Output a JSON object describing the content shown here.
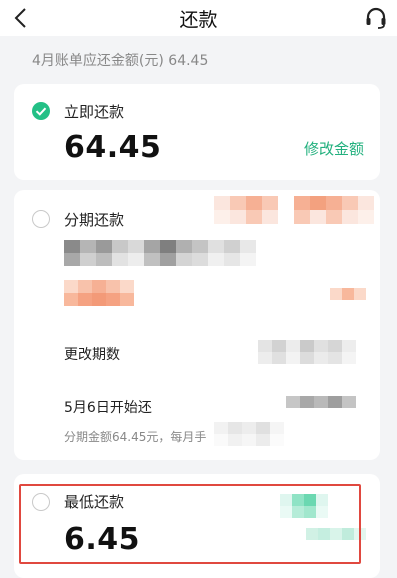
{
  "header": {
    "title": "还款",
    "back_icon": "chevron-left-icon",
    "support_icon": "headset-icon"
  },
  "bill": {
    "text": "4月账单应还金额(元) 64.45"
  },
  "options": {
    "immediate": {
      "label": "立即还款",
      "amount": "64.45",
      "edit_link": "修改金额",
      "selected": true
    },
    "installment": {
      "label": "分期还款",
      "change_term": "更改期数",
      "start_date": "5月6日开始还",
      "note": "分期金额64.45元，每月手",
      "selected": false
    },
    "minimum": {
      "label": "最低还款",
      "amount": "6.45",
      "selected": false
    }
  },
  "colors": {
    "accent": "#23c086",
    "highlight_border": "#e0483f"
  }
}
